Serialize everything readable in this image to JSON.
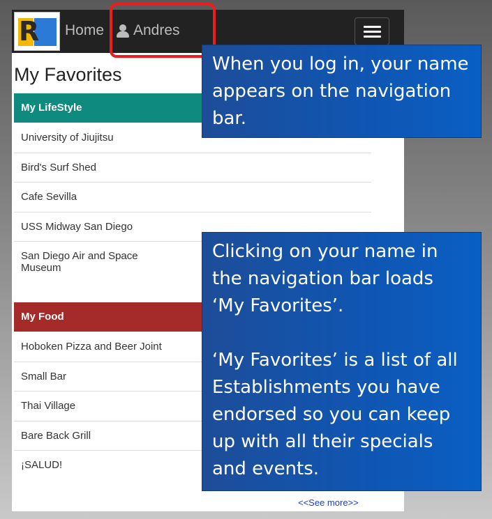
{
  "navbar": {
    "logo_letter": "R",
    "home_label": "Home",
    "user_name": "Andres"
  },
  "page_title": "My Favorites",
  "sections": [
    {
      "title": "My LifeStyle",
      "color": "#0f8a7e",
      "items": [
        "University of Jiujitsu",
        "Bird's Surf Shed",
        "Cafe Sevilla",
        "USS Midway San Diego",
        "San Diego Air and Space Museum"
      ]
    },
    {
      "title": "My Food",
      "color": "#a52a2a",
      "items": [
        "Hoboken Pizza and Beer Joint",
        "Small Bar",
        "Thai Village",
        "Bare Back Grill",
        "¡SALUD!"
      ]
    }
  ],
  "see_more": "<<See more>>",
  "callouts": {
    "first": "When you log in, your name appears on the navigation bar.",
    "second_a": "Clicking on your name in the navigation bar loads ‘My Favorites’.",
    "second_b": "‘My Favorites’ is a list of all Establishments you have endorsed so you can keep up with all their specials and events."
  },
  "icons": {
    "user": "user-icon",
    "menu": "hamburger-menu-icon",
    "logo": "logo-icon"
  }
}
